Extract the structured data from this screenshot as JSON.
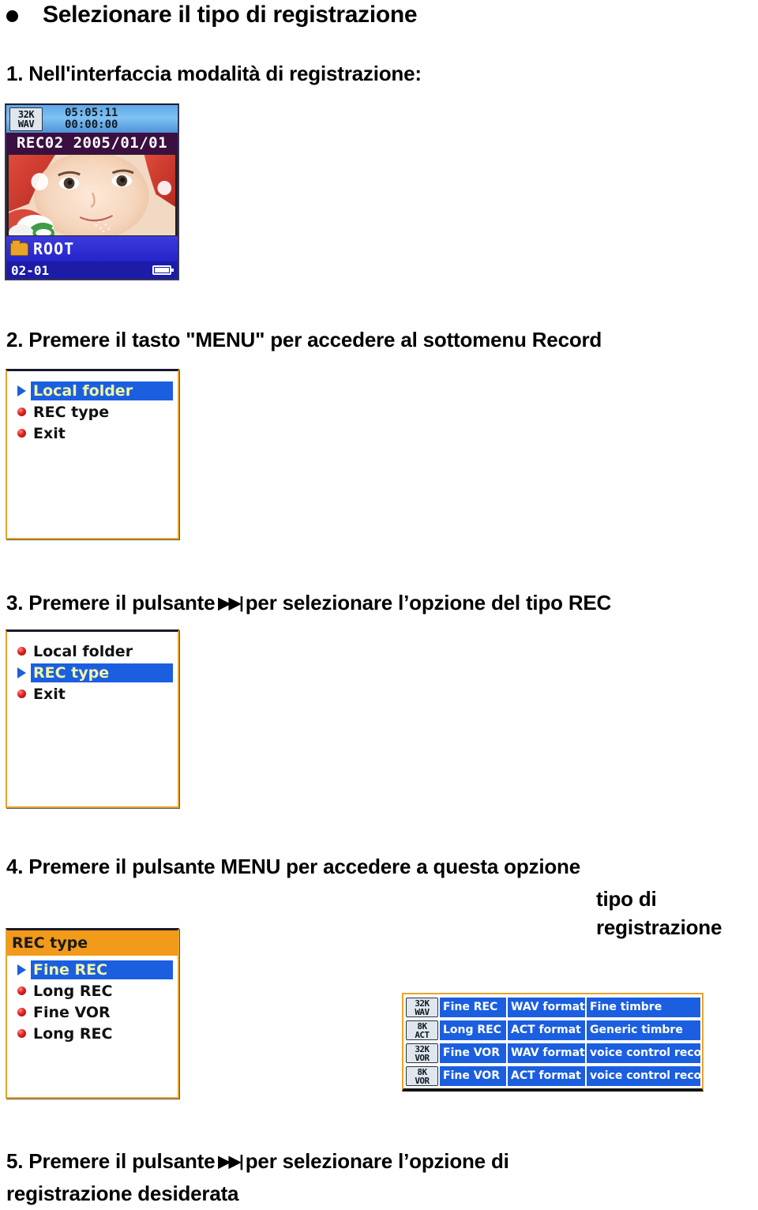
{
  "page": {
    "title": "Selezionare il tipo di registrazione",
    "bullet_icon": "bullet-dot-icon"
  },
  "steps": {
    "s1": "1. Nell'interfaccia modalità di registrazione:",
    "s2": "2. Premere il tasto \"MENU\" per accedere al sottomenu Record",
    "s3_a": "3. Premere il pulsante",
    "s3_icon": "▶▶|",
    "s3_b": "per selezionare l’opzione del tipo REC",
    "s4": "4. Premere il pulsante MENU per accedere a questa opzione",
    "s4_cont_line1": "tipo di",
    "s4_cont_line2": "registrazione",
    "s5_a": "5. Premere il pulsante",
    "s5_icon": "▶▶|",
    "s5_b": "per selezionare l’opzione di",
    "s5_line2": "registrazione desiderata"
  },
  "screen_record": {
    "badge_line1": "32K",
    "badge_line2": "WAV",
    "elapsed": "05:05:11",
    "remaining": "00:00:00",
    "title": "REC02 2005/01/01",
    "folder_icon": "folder-icon",
    "folder_name": "ROOT",
    "track": "02-01",
    "battery_icon": "battery-icon"
  },
  "menu_local": {
    "items": [
      {
        "label": "Local folder",
        "selected": true,
        "marker": "cursor-triangle-icon"
      },
      {
        "label": "REC type",
        "selected": false,
        "marker": "bullet-red-icon"
      },
      {
        "label": "Exit",
        "selected": false,
        "marker": "bullet-red-icon"
      }
    ]
  },
  "menu_rec": {
    "items": [
      {
        "label": "Local folder",
        "selected": false,
        "marker": "bullet-red-icon"
      },
      {
        "label": "REC type",
        "selected": true,
        "marker": "cursor-triangle-icon"
      },
      {
        "label": "Exit",
        "selected": false,
        "marker": "bullet-red-icon"
      }
    ]
  },
  "menu_type": {
    "header": "REC type",
    "items": [
      {
        "label": "Fine REC",
        "selected": true,
        "marker": "cursor-triangle-icon"
      },
      {
        "label": "Long REC",
        "selected": false,
        "marker": "bullet-red-icon"
      },
      {
        "label": "Fine VOR",
        "selected": false,
        "marker": "bullet-red-icon"
      },
      {
        "label": "Long REC",
        "selected": false,
        "marker": "bullet-red-icon"
      }
    ]
  },
  "rec_table": {
    "rows": [
      {
        "badge1": "32K",
        "badge2": "WAV",
        "mode": "Fine REC",
        "format": "WAV format",
        "desc": "Fine timbre"
      },
      {
        "badge1": "8K",
        "badge2": "ACT",
        "mode": "Long REC",
        "format": "ACT format",
        "desc": "Generic timbre"
      },
      {
        "badge1": "32K",
        "badge2": "VOR",
        "mode": "Fine VOR",
        "format": "WAV format",
        "desc": "voice control record"
      },
      {
        "badge1": "8K",
        "badge2": "VOR",
        "mode": "Fine VOR",
        "format": "ACT format",
        "desc": "voice control record"
      }
    ]
  },
  "colors": {
    "frame_border": "#e8a42a",
    "selection_blue": "#1b5fe0",
    "header_orange": "#f29a19",
    "title_purple": "#3b0f40",
    "topbar_blue": "#5fa8e8"
  }
}
